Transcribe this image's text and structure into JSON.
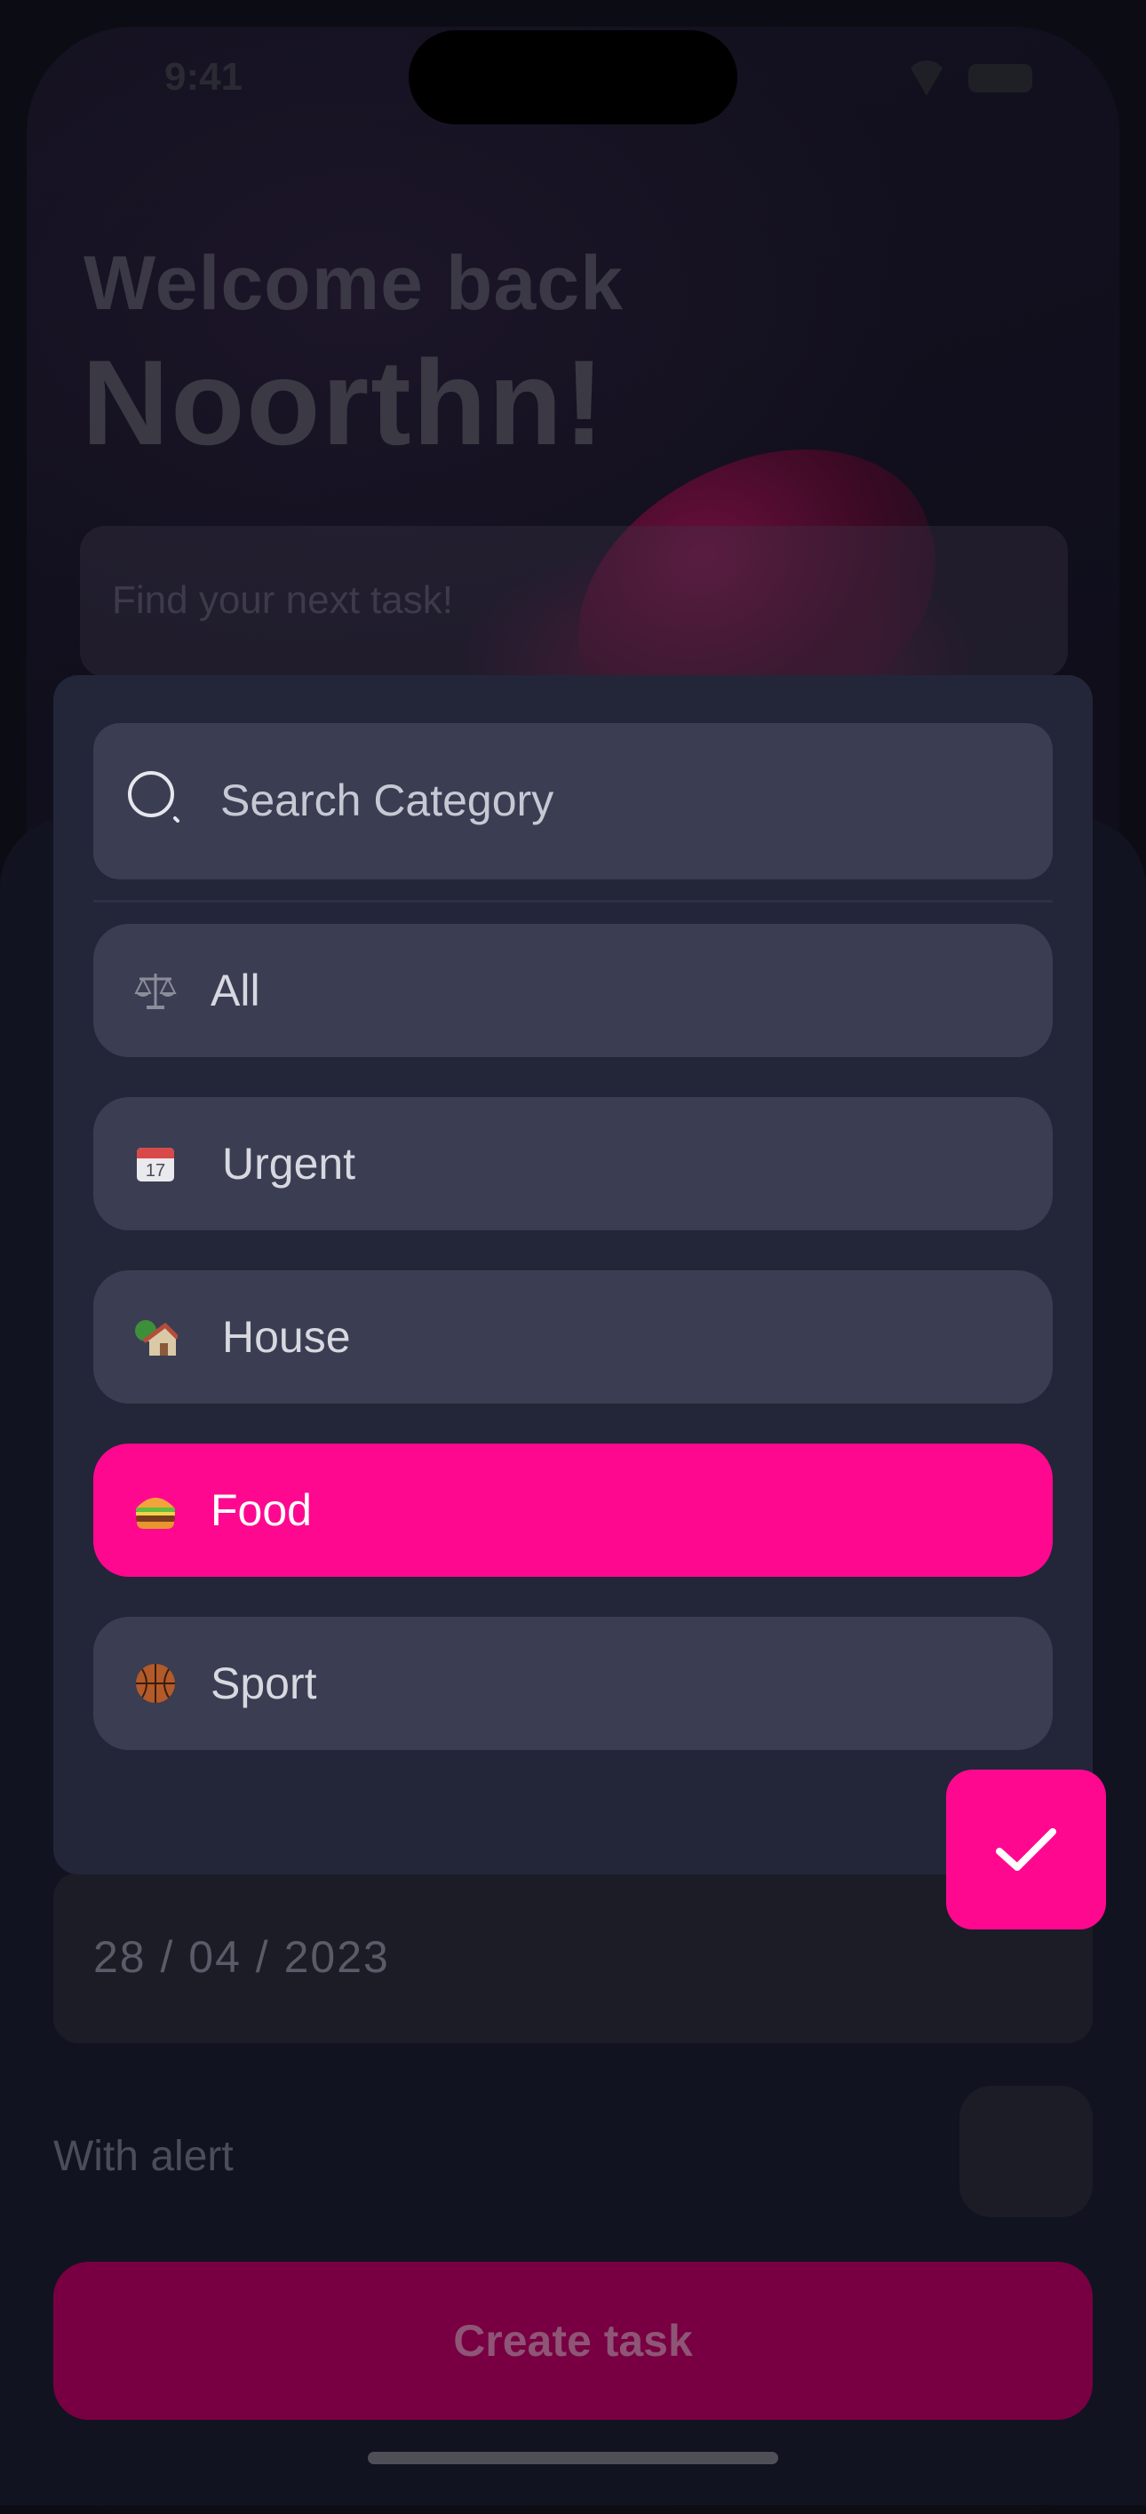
{
  "background_screen": {
    "status_time": "9:41",
    "welcome_line": "Welcome back",
    "user_name": "Noorthn!",
    "search_placeholder": "Find your next task!"
  },
  "form": {
    "date_value": "28 / 04 / 2023",
    "alert_label": "With alert",
    "alert_enabled": false,
    "create_button": "Create task"
  },
  "category_picker": {
    "search_placeholder": "Search Category",
    "selected": "Food",
    "categories": [
      {
        "label": "All",
        "icon": "scales-icon"
      },
      {
        "label": "Urgent",
        "icon": "calendar-icon"
      },
      {
        "label": "House",
        "icon": "house-icon"
      },
      {
        "label": "Food",
        "icon": "burger-icon"
      },
      {
        "label": "Sport",
        "icon": "basketball-icon"
      }
    ],
    "confirm_icon": "checkmark-icon"
  },
  "colors": {
    "accent": "#ff0890",
    "panel": "#222638",
    "item": "#3b3d52",
    "background": "#0c0d14"
  }
}
